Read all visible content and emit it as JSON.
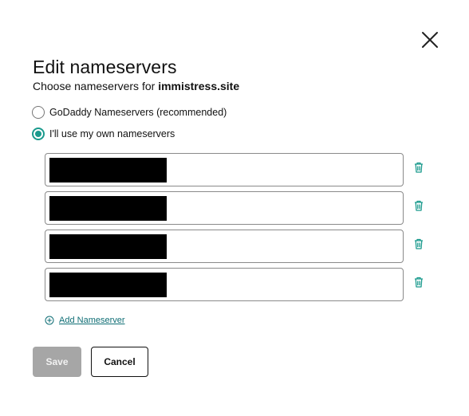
{
  "dialog": {
    "title": "Edit nameservers",
    "subtitle_prefix": "Choose nameservers for ",
    "domain": "immistress.site"
  },
  "options": [
    {
      "label": "GoDaddy Nameservers (recommended)",
      "selected": false
    },
    {
      "label": "I'll use my own nameservers",
      "selected": true
    }
  ],
  "nameservers": [
    {
      "value": "",
      "redacted": true
    },
    {
      "value": "",
      "redacted": true
    },
    {
      "value": "",
      "redacted": true
    },
    {
      "value": "",
      "redacted": true
    }
  ],
  "add_nameserver_label": "Add Nameserver",
  "buttons": {
    "save": "Save",
    "cancel": "Cancel"
  },
  "colors": {
    "accent": "#1a9a8d",
    "link": "#0f6e75",
    "save_disabled_bg": "#a6a6a6",
    "border": "#8a8a8a"
  },
  "icons": {
    "close": "close-icon",
    "delete": "trash-icon",
    "add": "plus-circle-icon"
  }
}
